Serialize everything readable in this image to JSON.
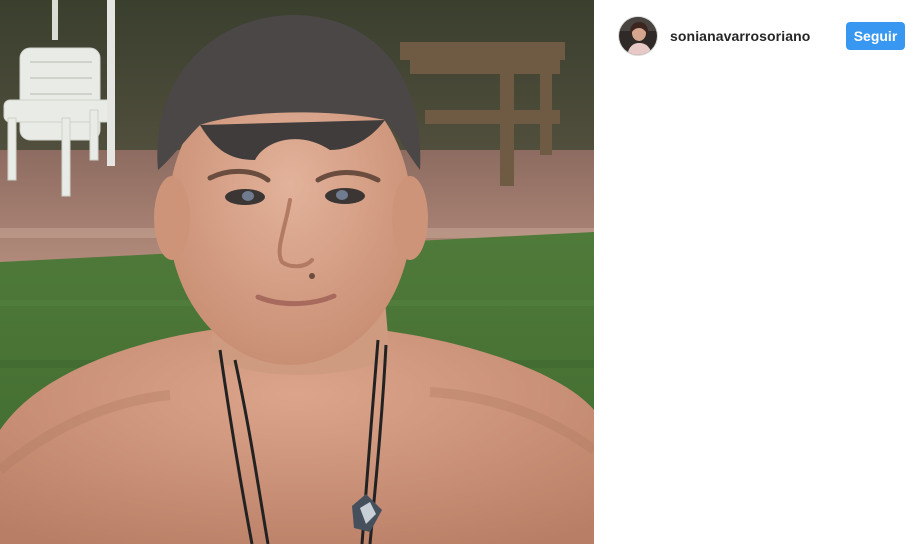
{
  "post": {
    "author": {
      "username": "sonianavarrosoriano",
      "avatar_icon": "profile-photo-avatar"
    },
    "follow_label": "Seguir"
  },
  "colors": {
    "follow_button": "#3897f0",
    "username": "#262626",
    "background": "#ffffff"
  }
}
